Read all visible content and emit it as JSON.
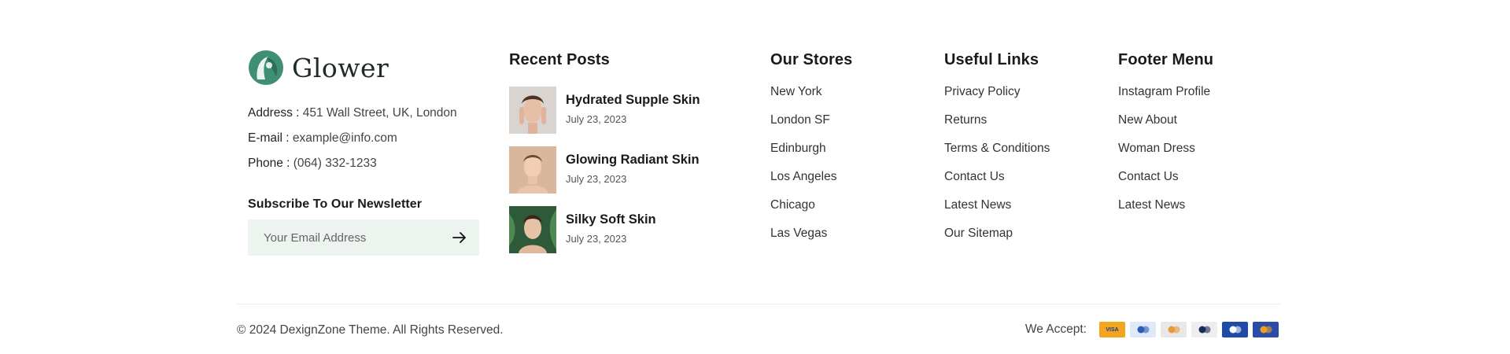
{
  "brand": {
    "name": "Glower",
    "contact": [
      {
        "label": "Address :",
        "value": "451 Wall Street, UK, London"
      },
      {
        "label": "E-mail :",
        "value": "example@info.com"
      },
      {
        "label": "Phone :",
        "value": "(064) 332-1233"
      }
    ],
    "newsletter_title": "Subscribe To Our Newsletter",
    "email_placeholder": "Your Email Address"
  },
  "recent_posts": {
    "title": "Recent Posts",
    "items": [
      {
        "title": "Hydrated Supple Skin",
        "date": "July 23, 2023"
      },
      {
        "title": "Glowing Radiant Skin",
        "date": "July 23, 2023"
      },
      {
        "title": "Silky Soft Skin",
        "date": "July 23, 2023"
      }
    ]
  },
  "stores": {
    "title": "Our Stores",
    "items": [
      "New York",
      "London SF",
      "Edinburgh",
      "Los Angeles",
      "Chicago",
      "Las Vegas"
    ]
  },
  "useful_links": {
    "title": "Useful Links",
    "items": [
      "Privacy Policy",
      "Returns",
      "Terms & Conditions",
      "Contact Us",
      "Latest News",
      "Our Sitemap"
    ]
  },
  "footer_menu": {
    "title": "Footer Menu",
    "items": [
      "Instagram Profile",
      "New About",
      "Woman Dress",
      "Contact Us",
      "Latest News"
    ]
  },
  "bottom": {
    "copyright": "© 2024 DexignZone Theme. All Rights Reserved.",
    "accept_label": "We Accept:",
    "cards": [
      {
        "icon": "visa-card-icon",
        "text": "VISA",
        "bg": "#f2a51f",
        "fg": "#1a3a8f"
      },
      {
        "icon": "bank-card-icon",
        "text": "",
        "bg": "#dfe9f7",
        "fg": "#2b5fb7"
      },
      {
        "icon": "mastercard-light-icon",
        "text": "",
        "bg": "#e8e8e8",
        "fg": "#e89b3a"
      },
      {
        "icon": "diners-card-icon",
        "text": "",
        "bg": "#eeeeee",
        "fg": "#1a2c5a"
      },
      {
        "icon": "amex-card-icon",
        "text": "",
        "bg": "#1f4aa8",
        "fg": "#ffffff"
      },
      {
        "icon": "mastercard-icon",
        "text": "",
        "bg": "#2b4ba8",
        "fg": "#f0a020"
      }
    ]
  }
}
